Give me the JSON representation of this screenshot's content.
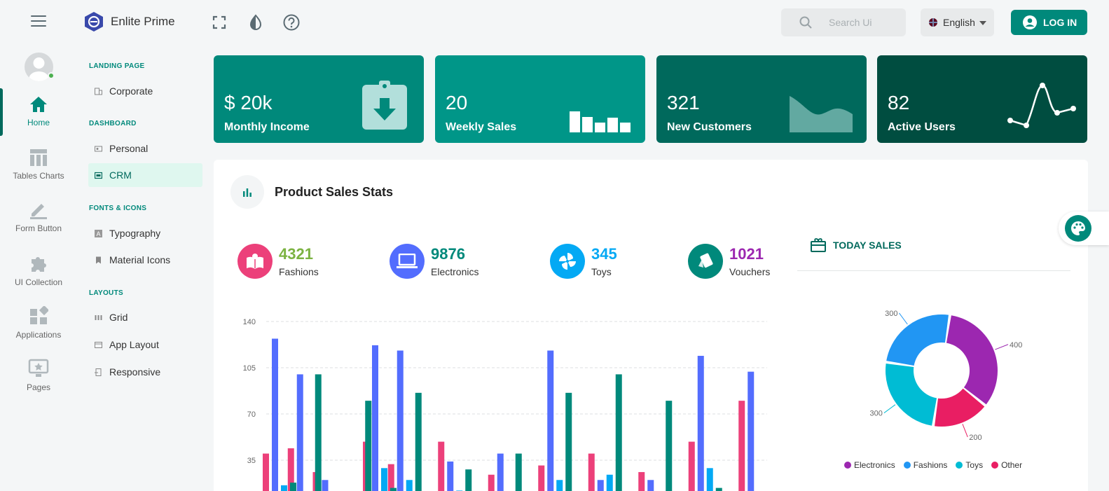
{
  "app": {
    "name": "Enlite Prime"
  },
  "header": {
    "search_placeholder": "Search Ui",
    "language": "English",
    "login_label": "LOG IN"
  },
  "rail": [
    {
      "label": "Home",
      "active": true
    },
    {
      "label": "Tables Charts"
    },
    {
      "label": "Form Button"
    },
    {
      "label": "UI Collection"
    },
    {
      "label": "Applications"
    },
    {
      "label": "Pages"
    }
  ],
  "submenu": {
    "sections": [
      {
        "heading": "LANDING PAGE",
        "items": [
          "Corporate"
        ]
      },
      {
        "heading": "DASHBOARD",
        "items": [
          "Personal",
          "CRM"
        ]
      },
      {
        "heading": "FONTS & ICONS",
        "items": [
          "Typography",
          "Material Icons"
        ]
      },
      {
        "heading": "LAYOUTS",
        "items": [
          "Grid",
          "App Layout",
          "Responsive"
        ]
      }
    ],
    "active_item": "CRM"
  },
  "stats": [
    {
      "value": "$ 20k",
      "label": "Monthly Income",
      "color": "#00897b"
    },
    {
      "value": "20",
      "label": "Weekly Sales",
      "color": "#009688"
    },
    {
      "value": "321",
      "label": "New Customers",
      "color": "#00695c"
    },
    {
      "value": "82",
      "label": "Active Users",
      "color": "#004d40"
    }
  ],
  "panel": {
    "title": "Product Sales Stats",
    "kpis": [
      {
        "value": "4321",
        "label": "Fashions",
        "color": "#7cb342",
        "circle": "#ec407a"
      },
      {
        "value": "9876",
        "label": "Electronics",
        "color": "#00897b",
        "circle": "#536dfe"
      },
      {
        "value": "345",
        "label": "Toys",
        "color": "#03a9f4",
        "circle": "#03a9f4"
      },
      {
        "value": "1021",
        "label": "Vouchers",
        "color": "#9c27b0",
        "circle": "#00897b"
      }
    ],
    "today_label": "TODAY SALES"
  },
  "chart_data": [
    {
      "type": "bar",
      "yticks": [
        "140",
        "105",
        "70",
        "35"
      ],
      "ylim": [
        0,
        140
      ],
      "grid": true,
      "series": [
        {
          "color": "#ec407a",
          "values": [
            40,
            44,
            26,
            0,
            49,
            32,
            0,
            49,
            0,
            24,
            0,
            31,
            0,
            40,
            0,
            26,
            0,
            49,
            0,
            80
          ]
        },
        {
          "color": "#536dfe",
          "values": [
            127,
            100,
            20,
            0,
            122,
            118,
            0,
            34,
            0,
            40,
            0,
            118,
            0,
            20,
            0,
            20,
            0,
            114,
            0,
            102
          ]
        },
        {
          "color": "#03a9f4",
          "values": [
            16,
            0,
            0,
            0,
            29,
            20,
            0,
            12,
            0,
            0,
            0,
            20,
            0,
            24,
            0,
            0,
            0,
            29,
            0,
            0
          ]
        },
        {
          "color": "#00897b",
          "values": [
            18,
            100,
            0,
            80,
            14,
            86,
            0,
            28,
            0,
            40,
            0,
            86,
            0,
            100,
            0,
            80,
            0,
            14,
            0,
            0
          ]
        }
      ]
    },
    {
      "type": "pie",
      "labels": [
        "Electronics",
        "Fashions",
        "Toys",
        "Other"
      ],
      "values": [
        400,
        300,
        300,
        200
      ],
      "colors": [
        "#9c27b0",
        "#2196f3",
        "#00bcd4",
        "#e91e63"
      ],
      "data_labels": [
        "400",
        "300",
        "300",
        "200"
      ],
      "legend": "bottom"
    }
  ]
}
